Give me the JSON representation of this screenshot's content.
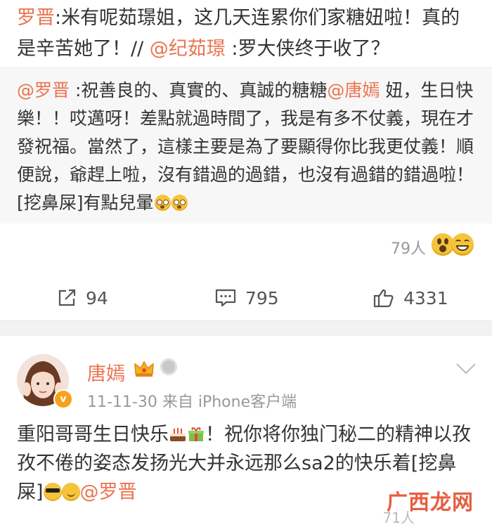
{
  "post": {
    "author_link": "罗晋",
    "text_a": ":米有呢茹璟姐，这几天连累你们家糖妞啦！真的是辛苦她了！// ",
    "mention": "@纪茹璟",
    "text_b": " :罗大侠终于收了？"
  },
  "repost": {
    "mention_author": "@罗晋",
    "text_a": " :祝善良的、真實的、真誠的糖糖",
    "mention_tang": "@唐嫣",
    "text_b": " 妞，生日快樂！！哎邁呀！差點就過時間了，我是有多不仗義，現在才發祝福。當然了，這樣主要是為了要顯得你比我更仗義！順便說，爺趕上啦，沒有錯過的過錯，也沒有過錯的錯過啦！[挖鼻屎]有點兒暈",
    "emoji_names": [
      "dizzy-face-icon",
      "dizzy-face-icon"
    ]
  },
  "reactions": {
    "count_text": "79人",
    "icons": [
      "surprised-face-icon",
      "laughing-face-icon"
    ]
  },
  "actions": {
    "share_count": "94",
    "comment_count": "795",
    "like_count": "4331"
  },
  "comment_card": {
    "user_name": "唐嫣",
    "timestamp": "11-11-30",
    "source": "来自 iPhone客户端",
    "text_a": "重阳哥哥生日快乐",
    "text_b": "！祝你将你独门秘二的精神以孜孜不倦的姿态发扬光大并永远那么sa2的快乐着[挖鼻屎]",
    "mention": "@罗晋",
    "bottom_partial": "71人"
  },
  "watermark": "广西龙网",
  "colors": {
    "link": "#eb7350",
    "text": "#333333",
    "muted": "#999999",
    "repost_bg": "#f7f7f7"
  }
}
